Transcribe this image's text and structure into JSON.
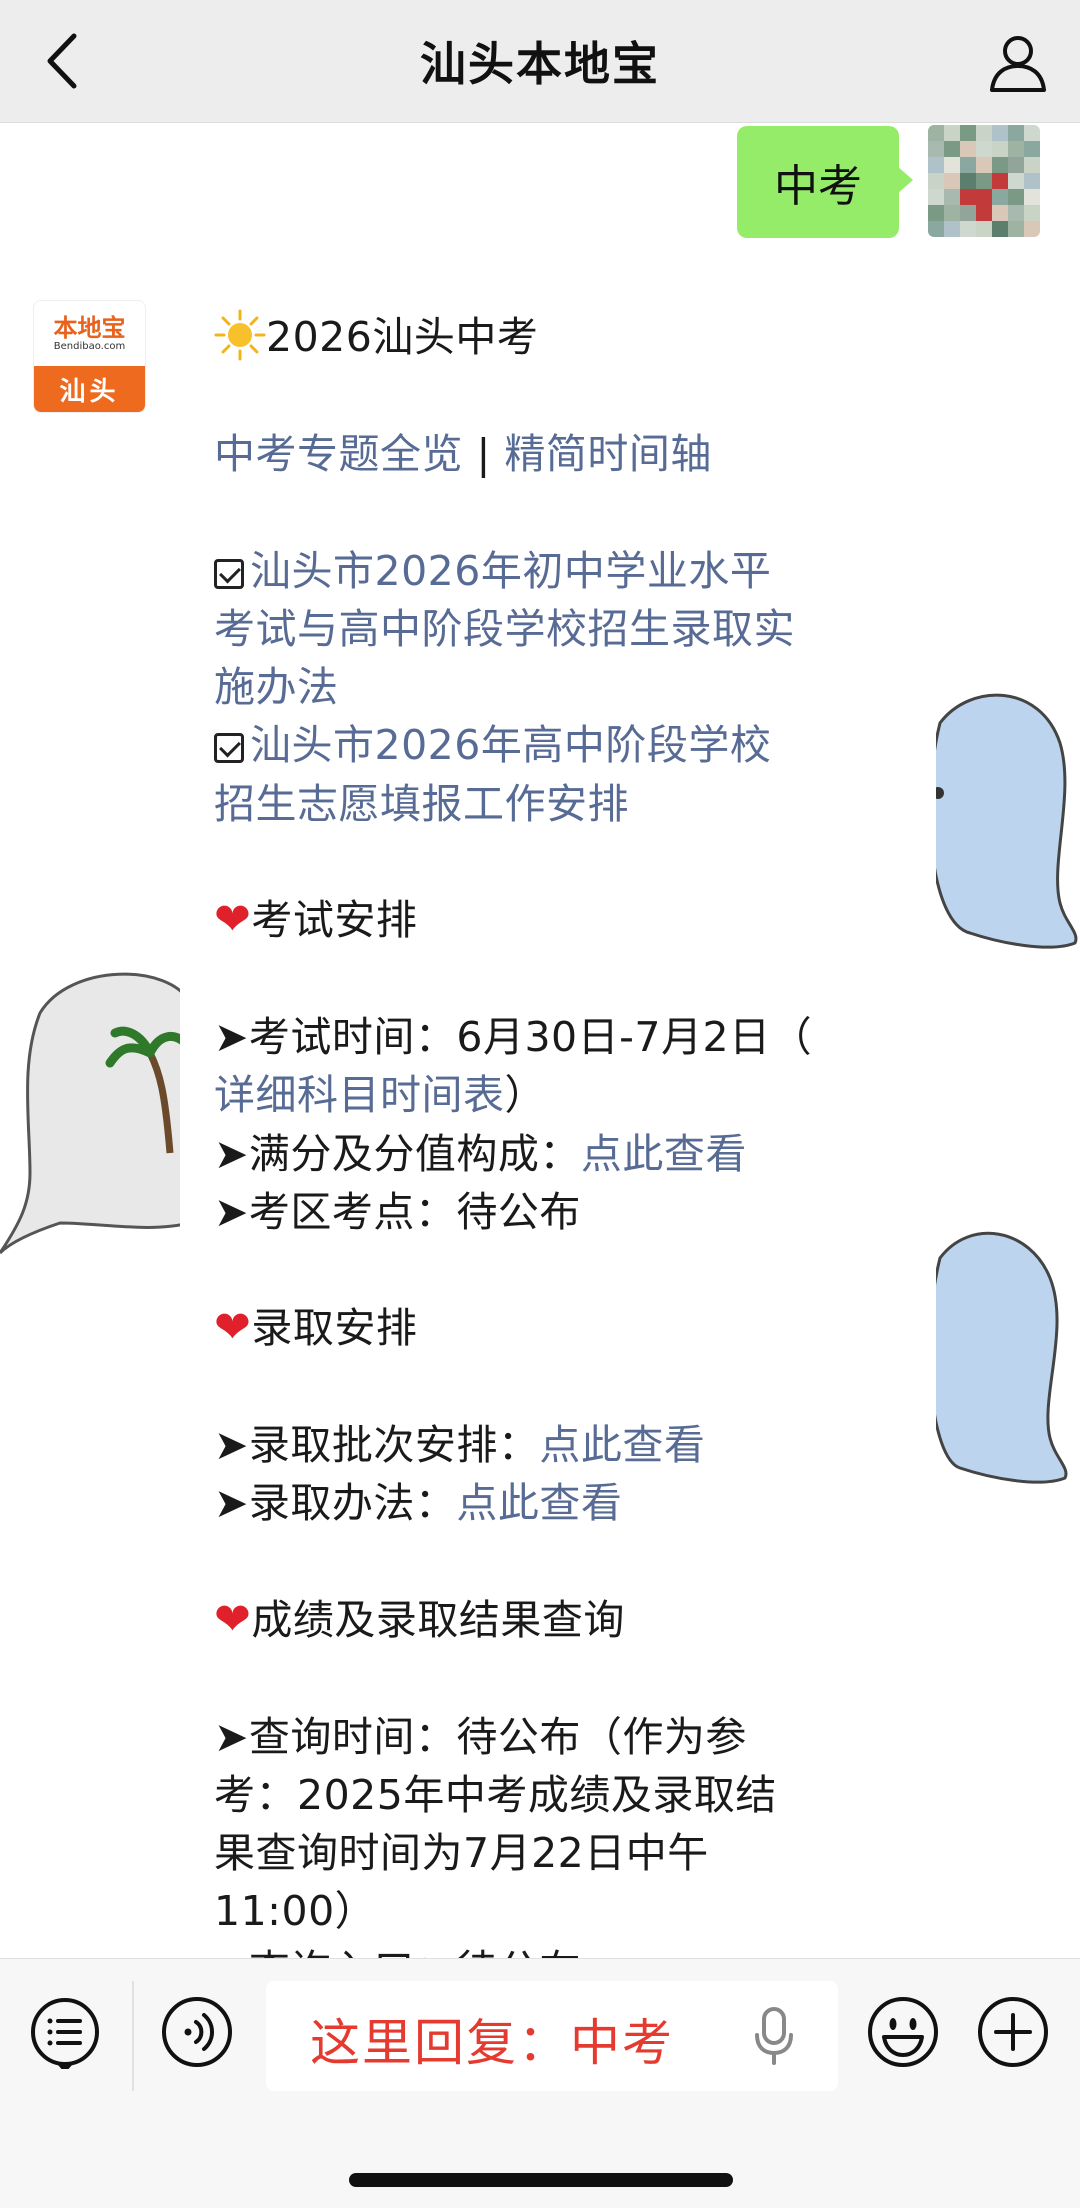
{
  "navbar": {
    "title": "汕头本地宝",
    "back_icon": "chevron-left-icon",
    "profile_icon": "person-icon"
  },
  "user_message": {
    "text": "中考",
    "bubble_color": "#95ec69"
  },
  "bot": {
    "avatar_brand": "本地宝",
    "avatar_domain": "Bendibao.com",
    "avatar_city": "汕头",
    "avatar_color": "#ee6a1f"
  },
  "message": {
    "title": "2026汕头中考",
    "links_row": {
      "link1": "中考专题全览",
      "separator": " | ",
      "link2": "精简时间轴"
    },
    "doc1": [
      "汕头市2026年初中学业水平",
      "考试与高中阶段学校招生录取实",
      "施办法"
    ],
    "doc2": [
      "汕头市2026年高中阶段学校",
      "招生志愿填报工作安排"
    ],
    "section1": {
      "heading": "考试安排",
      "item1_prefix": "➤考试时间：6月30日-7月2日（",
      "item1_link": "详细科目时间表",
      "item1_suffix": "）",
      "item2_prefix": "➤满分及分值构成：",
      "item2_link": "点此查看",
      "item3": "➤考区考点：待公布"
    },
    "section2": {
      "heading": "录取安排",
      "item1_prefix": "➤录取批次安排：",
      "item1_link": "点此查看",
      "item2_prefix": "➤录取办法：",
      "item2_link": "点此查看"
    },
    "section3": {
      "heading": "成绩及录取结果查询",
      "item1_lines": [
        "➤查询时间：待公布（作为参",
        "考：2025年中考成绩及录取结",
        "果查询时间为7月22日中午",
        "11:00）"
      ],
      "item2_partial": "➤查询入口：待公布"
    },
    "link_color": "#576b95",
    "heart": "❤"
  },
  "inputbar": {
    "text": "这里回复：中考",
    "text_color": "#e53a2f",
    "menu_icon": "menu-list-icon",
    "voice_icon": "voice-icon",
    "mic_icon": "microphone-icon",
    "emoji_icon": "emoji-icon",
    "plus_icon": "plus-icon"
  }
}
